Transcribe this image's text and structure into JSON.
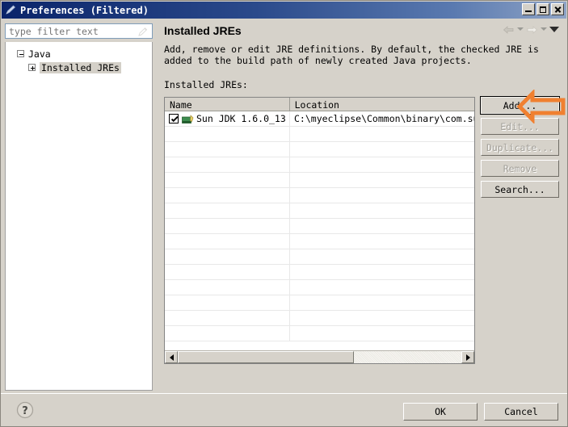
{
  "window": {
    "title": "Preferences (Filtered)",
    "icon": "preferences-pen-icon",
    "minimize_label": "Minimize",
    "maximize_label": "Maximize",
    "close_label": "Close",
    "titlebar_color": "#0a246a",
    "dialog_bg": "#d6d2ca"
  },
  "sidebar": {
    "filter": {
      "value": "",
      "placeholder": "type filter text",
      "clear_icon": "clear-filter-icon"
    },
    "tree": [
      {
        "label": "Java",
        "level": 1,
        "expanded": true,
        "selected": false
      },
      {
        "label": "Installed JREs",
        "level": 2,
        "expanded": false,
        "selected": true
      }
    ]
  },
  "page": {
    "title": "Installed JREs",
    "description": "Add, remove or edit JRE definitions. By default,  the checked JRE is added to the build path of newly created Java projects.",
    "section_label": "Installed JREs:",
    "nav": {
      "back_icon": "arrow-left-icon",
      "back_menu_icon": "chevron-down-icon",
      "forward_icon": "arrow-right-icon",
      "forward_menu_icon": "chevron-down-icon",
      "view_menu_icon": "triangle-down-icon"
    }
  },
  "table": {
    "columns": [
      "Name",
      "Location"
    ],
    "rows": [
      {
        "checked": true,
        "icon": "jre-icon",
        "name": "Sun JDK 1.6.0_13",
        "location": "C:\\myeclipse\\Common\\binary\\com.sun.ja"
      }
    ],
    "empty_row_count": 14,
    "scrollbar": {
      "left_arrow": "scroll-left-icon",
      "right_arrow": "scroll-right-icon",
      "thumb_percent": 62
    }
  },
  "side_buttons": [
    {
      "label": "Add...",
      "enabled": true,
      "focused": true
    },
    {
      "label": "Edit...",
      "enabled": false,
      "focused": false
    },
    {
      "label": "Duplicate...",
      "enabled": false,
      "focused": false
    },
    {
      "label": "Remove",
      "enabled": false,
      "focused": false
    },
    {
      "label": "Search...",
      "enabled": true,
      "focused": false
    }
  ],
  "annotation": {
    "type": "arrow-left-annotation",
    "color": "#f08030",
    "points_at": "Add..."
  },
  "footer": {
    "help_icon": "help-question-icon",
    "ok_label": "OK",
    "cancel_label": "Cancel"
  }
}
